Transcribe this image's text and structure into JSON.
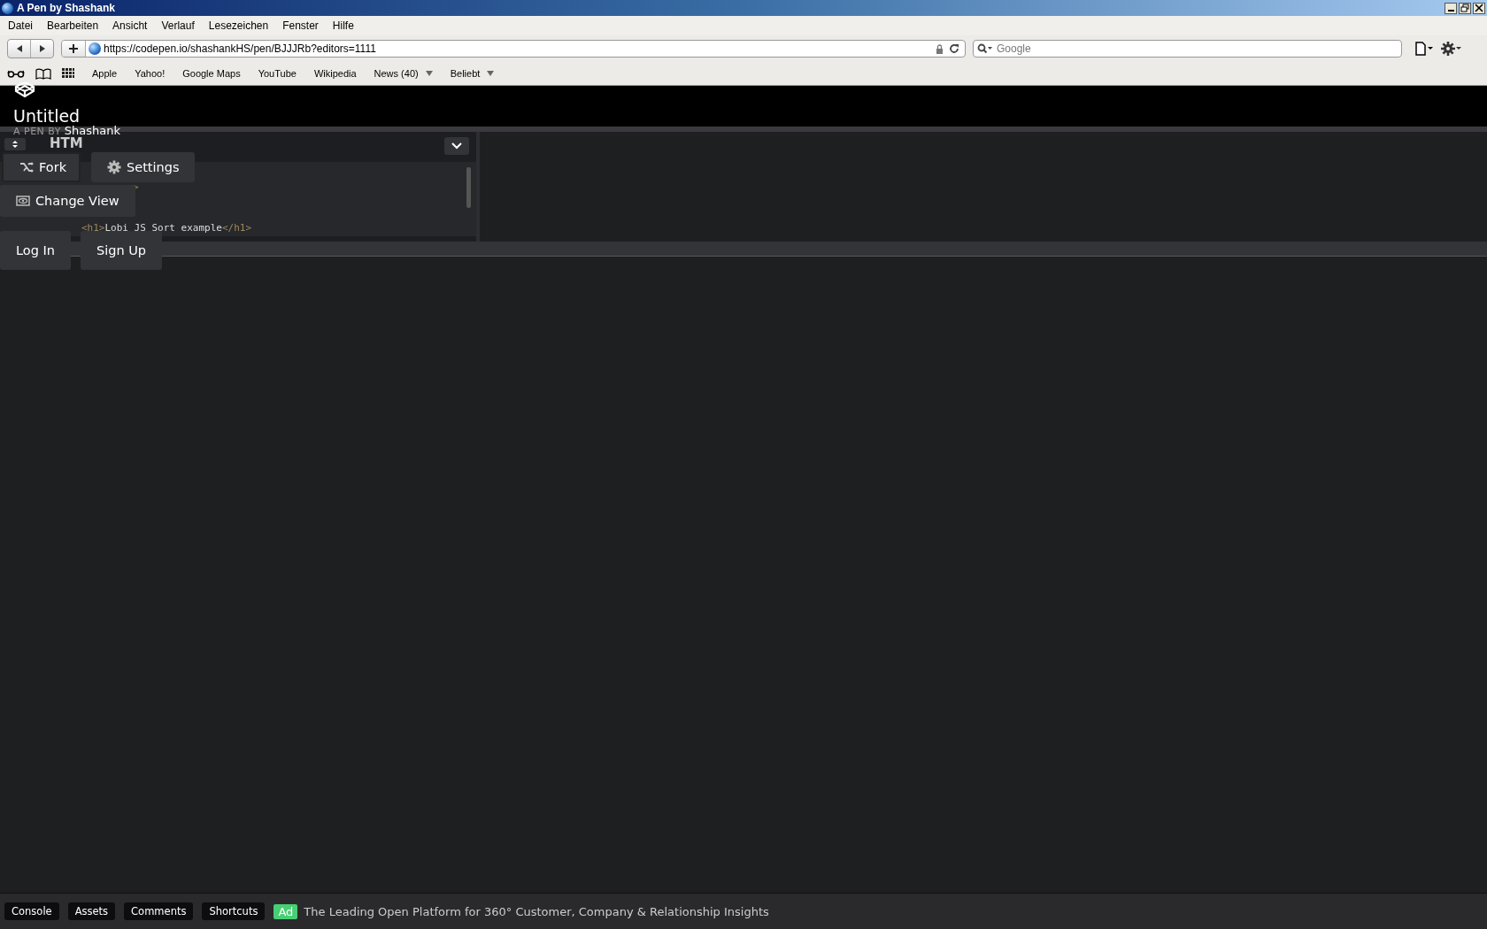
{
  "window": {
    "title": "A Pen by Shashank"
  },
  "menu": [
    "Datei",
    "Bearbeiten",
    "Ansicht",
    "Verlauf",
    "Lesezeichen",
    "Fenster",
    "Hilfe"
  ],
  "address": {
    "value": "https://codepen.io/shashankHS/pen/BJJJRb?editors=1111"
  },
  "search": {
    "placeholder": "Google"
  },
  "bookmarks": [
    {
      "label": "Apple",
      "dropdown": false
    },
    {
      "label": "Yahoo!",
      "dropdown": false
    },
    {
      "label": "Google Maps",
      "dropdown": false
    },
    {
      "label": "YouTube",
      "dropdown": false
    },
    {
      "label": "Wikipedia",
      "dropdown": false
    },
    {
      "label": "News (40)",
      "dropdown": true
    },
    {
      "label": "Beliebt",
      "dropdown": true
    }
  ],
  "pen": {
    "title": "Untitled",
    "byline": "A PEN BY",
    "author": "Shashank"
  },
  "editor": {
    "label": "HTM",
    "lines": [
      ">",
      "<h1>Lobi JS Sort example</h1>"
    ]
  },
  "actions": [
    {
      "label": "Fork",
      "kind": "fork"
    },
    {
      "label": "Settings",
      "kind": "settings"
    },
    {
      "label": "Change View",
      "kind": "view"
    },
    {
      "label": "Log In",
      "kind": "plain"
    },
    {
      "label": "Sign Up",
      "kind": "plain"
    }
  ],
  "footer": {
    "buttons": [
      "Console",
      "Assets",
      "Comments",
      "Shortcuts"
    ],
    "ad_badge": "Ad",
    "ad_text": "The Leading Open Platform for 360° Customer, Company & Relationship Insights"
  }
}
